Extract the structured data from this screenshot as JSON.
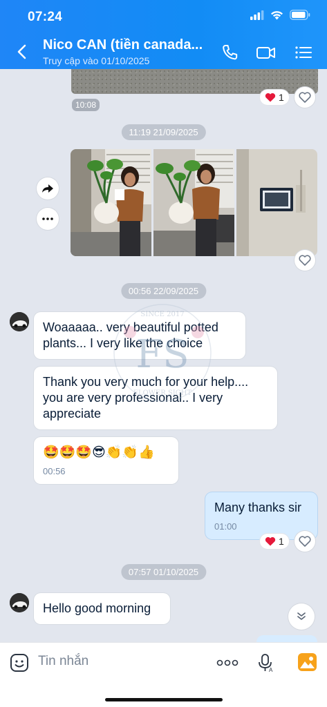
{
  "status_bar": {
    "time": "07:24"
  },
  "header": {
    "title": "Nico CAN (tiền canada...",
    "subtitle": "Truy cập vào 01/10/2025"
  },
  "messages": {
    "first_time": "10:08",
    "first_reaction_count": "1",
    "date_1": "11:19 21/09/2025",
    "date_2": "00:56 22/09/2025",
    "incoming_1": "Woaaaaa.. very beautiful potted plants... I very like the choice",
    "incoming_2": "Thank you very much for your help.... you are very professional.. I very appreciate",
    "incoming_3": "🤩🤩🤩😎👏👏👍",
    "incoming_3_time": "00:56",
    "outgoing_1": "Many thanks sir",
    "outgoing_1_time": "01:00",
    "outgoing_reaction_count": "1",
    "date_3": "07:57 01/10/2025",
    "incoming_4": "Hello good morning"
  },
  "watermark": {
    "top_text": "SINCE 2017",
    "monogram": "FS",
    "bottom_text": "FLOWER SIGHT"
  },
  "composer": {
    "placeholder": "Tin nhắn"
  },
  "icons": [
    "back-icon",
    "phone-icon",
    "video-call-icon",
    "menu-list-icon",
    "forward-icon",
    "more-icon",
    "heart-icon",
    "sticker-icon",
    "more-options-icon",
    "voice-icon",
    "image-icon",
    "chevron-down-icon"
  ]
}
